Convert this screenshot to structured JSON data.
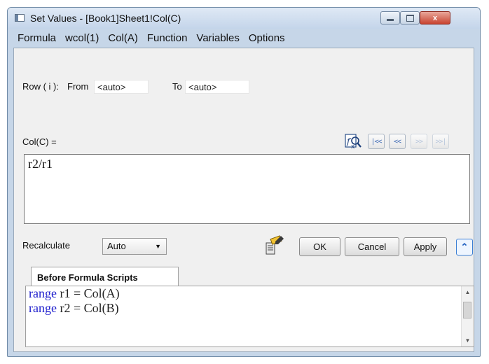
{
  "window": {
    "title": "Set Values - [Book1]Sheet1!Col(C)",
    "controls": {
      "minimize_icon": "minimize-icon",
      "maximize_icon": "maximize-icon",
      "close_label": "x"
    }
  },
  "menubar": [
    "Formula",
    "wcol(1)",
    "Col(A)",
    "Function",
    "Variables",
    "Options"
  ],
  "row": {
    "label": "Row ( i ):",
    "from_label": "From",
    "from_value": "<auto>",
    "to_label": "To",
    "to_value": "<auto>"
  },
  "formula": {
    "label": "Col(C) =",
    "value": "r2/r1",
    "nav": [
      "|<<",
      "<<",
      ">>",
      ">>|"
    ]
  },
  "recalculate": {
    "label": "Recalculate",
    "value": "Auto"
  },
  "buttons": {
    "ok": "OK",
    "cancel": "Cancel",
    "apply": "Apply",
    "collapse": "⌃"
  },
  "scripts": {
    "tab_label": "Before Formula Scripts",
    "lines": [
      {
        "keyword": "range",
        "rest": " r1 = Col(A)"
      },
      {
        "keyword": "range",
        "rest": " r2 = Col(B)"
      }
    ]
  },
  "colors": {
    "keyword": "#1c1ccc",
    "accent": "#3c7fd4",
    "close": "#c84431"
  }
}
